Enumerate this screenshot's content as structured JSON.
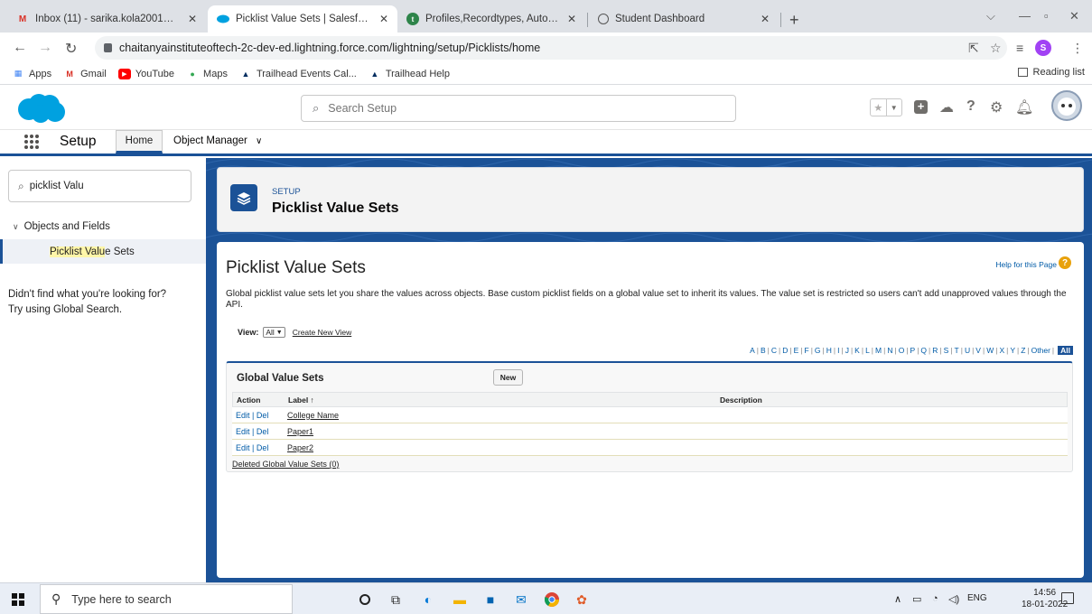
{
  "browser": {
    "tabs": [
      {
        "label": "Inbox (11) - sarika.kola2001@gm",
        "favicon": "gmail-icon"
      },
      {
        "label": "Picklist Value Sets | Salesforce",
        "favicon": "salesforce-icon"
      },
      {
        "label": "Profiles,Recordtypes, Automatio",
        "favicon": "trailhead-icon"
      },
      {
        "label": "Student Dashboard",
        "favicon": "globe-icon"
      }
    ],
    "url": "chaitanyainstituteoftech-2c-dev-ed.lightning.force.com/lightning/setup/Picklists/home",
    "profile_initial": "S",
    "bookmarks": [
      "Apps",
      "Gmail",
      "YouTube",
      "Maps",
      "Trailhead Events Cal...",
      "Trailhead Help"
    ],
    "reading_list": "Reading list"
  },
  "sf_header": {
    "search_placeholder": "Search Setup"
  },
  "sf_nav": {
    "app_name": "Setup",
    "home": "Home",
    "object_manager": "Object Manager"
  },
  "sidebar": {
    "search_value": "picklist Valu",
    "section": "Objects and Fields",
    "item_match": "Picklist Valu",
    "item_rest": "e Sets",
    "help_line1": "Didn't find what you're looking for?",
    "help_line2": "Try using Global Search."
  },
  "page_header": {
    "kicker": "SETUP",
    "title": "Picklist Value Sets"
  },
  "content": {
    "title": "Picklist Value Sets",
    "help_link": "Help for this Page",
    "description": "Global picklist value sets let you share the values across objects. Base custom picklist fields on a global value set to inherit its values. The value set is restricted so users can't add unapproved values through the API.",
    "view_label": "View:",
    "view_value": "All",
    "create_view": "Create New View",
    "alphabet": [
      "A",
      "B",
      "C",
      "D",
      "E",
      "F",
      "G",
      "H",
      "I",
      "J",
      "K",
      "L",
      "M",
      "N",
      "O",
      "P",
      "Q",
      "R",
      "S",
      "T",
      "U",
      "V",
      "W",
      "X",
      "Y",
      "Z",
      "Other"
    ],
    "alphabet_all": "All"
  },
  "list": {
    "title": "Global Value Sets",
    "new_button": "New",
    "columns": {
      "action": "Action",
      "label": "Label ↑",
      "description": "Description"
    },
    "rows": [
      {
        "edit": "Edit",
        "del": "Del",
        "label": "College Name",
        "description": ""
      },
      {
        "edit": "Edit",
        "del": "Del",
        "label": "Paper1",
        "description": ""
      },
      {
        "edit": "Edit",
        "del": "Del",
        "label": "Paper2",
        "description": ""
      }
    ],
    "deleted_link": "Deleted Global Value Sets (0)"
  },
  "taskbar": {
    "search_placeholder": "Type here to search",
    "lang": "ENG",
    "time": "14:56",
    "date": "18-01-2022"
  },
  "colors": {
    "brand": "#1b5297",
    "link": "#015ba7",
    "salesforce_cloud": "#00a1e0"
  }
}
